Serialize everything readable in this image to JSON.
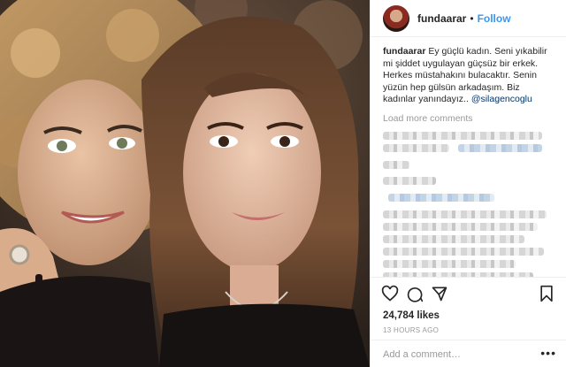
{
  "post": {
    "username": "fundaarar",
    "separator": "•",
    "follow_label": "Follow",
    "caption": {
      "user": "fundaarar",
      "text": "Ey güçlü kadın. Seni yıkabilir mi şiddet uygulayan güçsüz bir erkek. Herkes müstahakını bulacaktır. Senin yüzün hep gülsün arkadaşım. Biz kadınlar yanındayız..",
      "mention": "@silagencoglu"
    },
    "load_more_label": "Load more comments",
    "likes": "24,784 likes",
    "timestamp": "13 HOURS AGO",
    "comment_placeholder": "Add a comment…",
    "more_options": "•••"
  },
  "icons": {
    "like": "heart-icon",
    "comment": "comment-icon",
    "share": "share-icon",
    "save": "bookmark-icon",
    "more": "more-options-icon"
  },
  "colors": {
    "accent": "#3897f0",
    "text": "#262626",
    "muted": "#999999",
    "border": "#efefef",
    "mention": "#003569"
  }
}
